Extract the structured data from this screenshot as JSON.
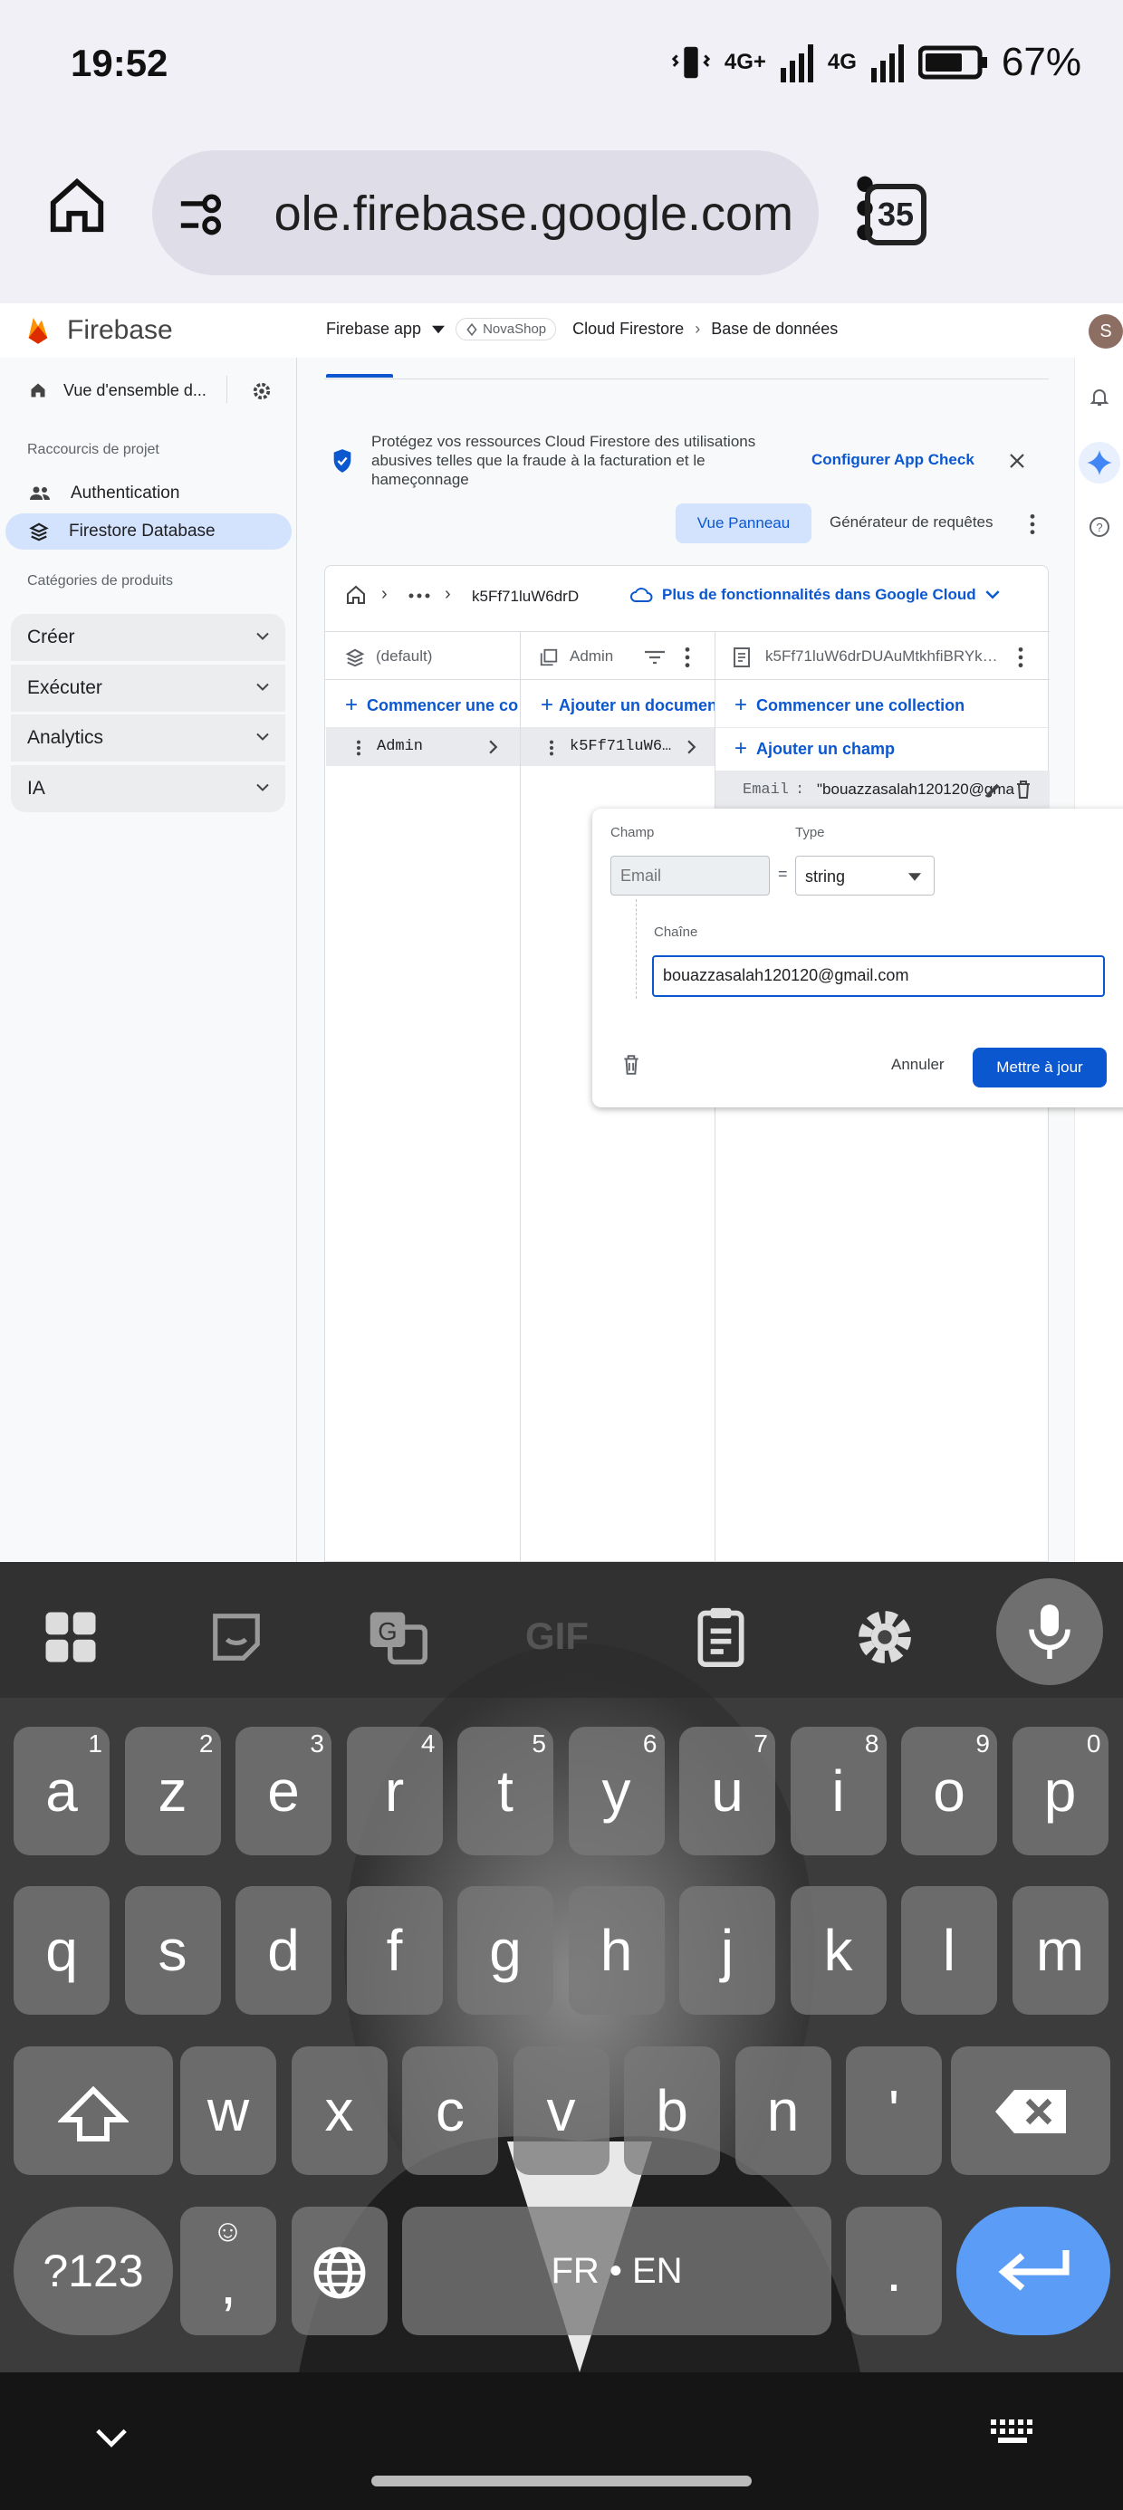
{
  "status": {
    "time": "19:52",
    "net1": "4G+",
    "net2": "4G",
    "battery": "67%"
  },
  "browser": {
    "url": "ole.firebase.google.com",
    "tab_count": "35"
  },
  "firebase": {
    "logo_text": "Firebase",
    "breadcrumb": {
      "app": "Firebase app",
      "project_chip": "NovaShop",
      "product": "Cloud Firestore",
      "page": "Base de données"
    },
    "avatar_letter": "S",
    "sidebar": {
      "overview": "Vue d'ensemble d...",
      "shortcuts_title": "Raccourcis de projet",
      "shortcuts": [
        "Authentication",
        "Firestore Database"
      ],
      "categories_title": "Catégories de produits",
      "categories": [
        "Créer",
        "Exécuter",
        "Analytics",
        "IA"
      ]
    },
    "banner": {
      "text": "Protégez vos ressources Cloud Firestore des utilisations abusives telles que la fraude à la facturation et le hameçonnage",
      "action": "Configurer App Check"
    },
    "view_toggle": {
      "panel": "Vue Panneau",
      "query": "Générateur de requêtes"
    },
    "path": {
      "doc": "k5Ff71luW6drD",
      "more_cloud": "Plus de fonctionnalités dans Google Cloud"
    },
    "columns": {
      "col1": {
        "title": "(default)",
        "action": "Commencer une collection",
        "item": "Admin"
      },
      "col2": {
        "title": "Admin",
        "action": "Ajouter un document",
        "item": "k5Ff71luW6…"
      },
      "col3": {
        "title": "k5Ff71luW6drDUAuMtkhfiBRYk…",
        "action1": "Commencer une collection",
        "action2": "Ajouter un champ",
        "field_key": "Email",
        "field_value": "\"bouazzasalah120120@gma"
      }
    },
    "editor": {
      "field_label": "Champ",
      "field_placeholder": "Email",
      "equals": "=",
      "type_label": "Type",
      "type_value": "string",
      "value_label": "Chaîne",
      "value": "bouazzasalah120120@gmail.com",
      "cancel": "Annuler",
      "submit": "Mettre à jour"
    }
  },
  "keyboard": {
    "toolbar": [
      "apps-icon",
      "sticker-icon",
      "translate-icon",
      "GIF",
      "clipboard-icon",
      "settings-icon",
      "mic-icon"
    ],
    "gif_label": "GIF",
    "row1": [
      {
        "k": "a",
        "h": "1"
      },
      {
        "k": "z",
        "h": "2"
      },
      {
        "k": "e",
        "h": "3"
      },
      {
        "k": "r",
        "h": "4"
      },
      {
        "k": "t",
        "h": "5"
      },
      {
        "k": "y",
        "h": "6"
      },
      {
        "k": "u",
        "h": "7"
      },
      {
        "k": "i",
        "h": "8"
      },
      {
        "k": "o",
        "h": "9"
      },
      {
        "k": "p",
        "h": "0"
      }
    ],
    "row2": [
      "q",
      "s",
      "d",
      "f",
      "g",
      "h",
      "j",
      "k",
      "l",
      "m"
    ],
    "row3": [
      "w",
      "x",
      "c",
      "v",
      "b",
      "n",
      "'"
    ],
    "symbols": "?123",
    "comma": ",",
    "space": "FR • EN",
    "period": "."
  }
}
